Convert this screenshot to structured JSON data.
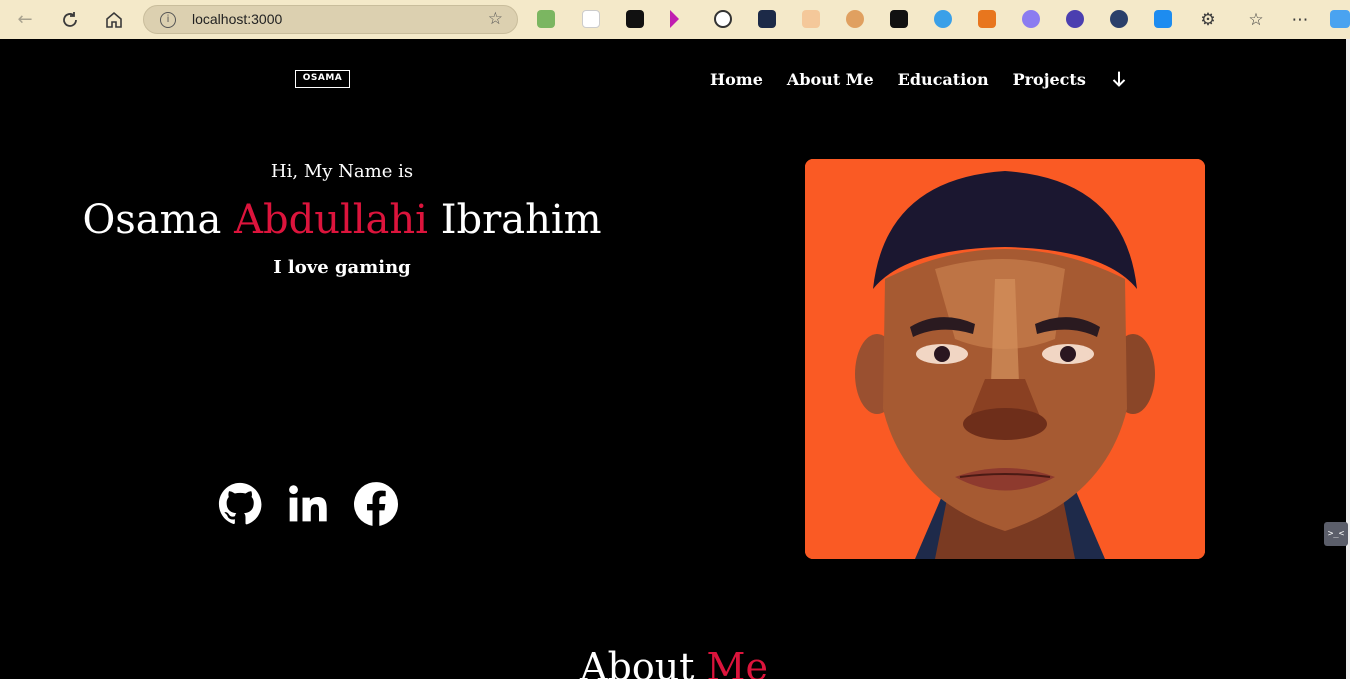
{
  "browser": {
    "url": "localhost:3000",
    "back_icon": "arrow-left-icon",
    "refresh_icon": "refresh-icon",
    "home_icon": "home-icon",
    "info_icon": "info-icon",
    "favorite_icon": "star-icon",
    "menu_icon": "more-icon"
  },
  "site": {
    "logo": "OSAMA",
    "nav": [
      "Home",
      "About Me",
      "Education",
      "Projects"
    ],
    "nav_more_icon": "arrow-down-icon"
  },
  "hero": {
    "intro": "Hi, My Name is",
    "first_name": "Osama",
    "middle_name": "Abdullahi",
    "last_name": "Ibrahim",
    "tagline": "I love gaming",
    "accent_color": "#dc143c",
    "social_icons": [
      "github-icon",
      "linkedin-icon",
      "facebook-icon"
    ]
  },
  "portrait": {
    "background_color": "#fa5a24"
  },
  "about": {
    "word1": "About",
    "word2": "Me"
  }
}
